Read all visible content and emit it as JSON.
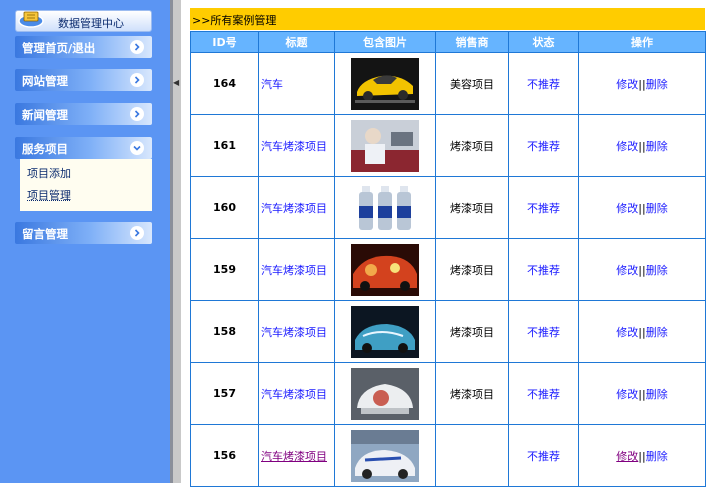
{
  "sidebar": {
    "header_title": "数据管理中心",
    "menus": [
      {
        "label": "管理首页/退出"
      },
      {
        "label": "网站管理"
      },
      {
        "label": "新闻管理"
      },
      {
        "label": "服务项目"
      },
      {
        "label": "留言管理"
      }
    ],
    "submenu": [
      {
        "label": "项目添加"
      },
      {
        "label": "项目管理"
      }
    ]
  },
  "main": {
    "section_title": ">>所有案例管理",
    "columns": [
      "ID号",
      "标题",
      "包含图片",
      "销售商",
      "状态",
      "操作"
    ],
    "rows": [
      {
        "id": "164",
        "title": "汽车",
        "thumb_icon": "yellow-sports-car",
        "seller": "美容项目",
        "status": "不推荐",
        "edit": "修改",
        "sep": "||",
        "del": "删除"
      },
      {
        "id": "161",
        "title": "汽车烤漆项目",
        "thumb_icon": "painter-spraying-car",
        "seller": "烤漆项目",
        "status": "不推荐",
        "edit": "修改",
        "sep": "||",
        "del": "删除"
      },
      {
        "id": "160",
        "title": "汽车烤漆项目",
        "thumb_icon": "spray-paint-cans",
        "seller": "烤漆项目",
        "status": "不推荐",
        "edit": "修改",
        "sep": "||",
        "del": "删除"
      },
      {
        "id": "159",
        "title": "汽车烤漆项目",
        "thumb_icon": "custom-painted-car",
        "seller": "烤漆项目",
        "status": "不推荐",
        "edit": "修改",
        "sep": "||",
        "del": "删除"
      },
      {
        "id": "158",
        "title": "汽车烤漆项目",
        "thumb_icon": "blue-graphic-car",
        "seller": "烤漆项目",
        "status": "不推荐",
        "edit": "修改",
        "sep": "||",
        "del": "删除"
      },
      {
        "id": "157",
        "title": "汽车烤漆项目",
        "thumb_icon": "white-car-front",
        "seller": "烤漆项目",
        "status": "不推荐",
        "edit": "修改",
        "sep": "||",
        "del": "删除"
      },
      {
        "id": "156",
        "title": "汽车烤漆项目",
        "thumb_icon": "white-car-with-crowd",
        "seller": "",
        "status": "不推荐",
        "edit": "修改",
        "sep": "||",
        "del": "删除"
      }
    ]
  },
  "colors": {
    "sidebar_bg": "#5b95f3",
    "title_bar": "#ffcc00",
    "table_header": "#66b4ff",
    "link": "#1a1aff",
    "visited_link": "#800080"
  }
}
